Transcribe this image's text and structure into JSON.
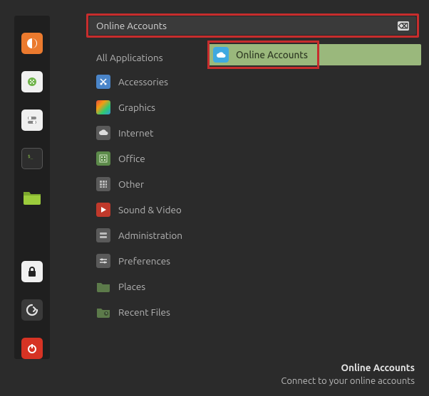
{
  "panel": {
    "items": [
      {
        "name": "firefox-icon"
      },
      {
        "name": "apps-icon"
      },
      {
        "name": "settings-icon"
      },
      {
        "name": "terminal-icon"
      },
      {
        "name": "files-icon"
      }
    ],
    "bottom": [
      {
        "name": "lock-icon"
      },
      {
        "name": "logout-icon"
      },
      {
        "name": "power-icon"
      }
    ]
  },
  "search": {
    "value": "Online Accounts"
  },
  "categories": [
    {
      "label": "All Applications",
      "heading": true
    },
    {
      "label": "Accessories"
    },
    {
      "label": "Graphics"
    },
    {
      "label": "Internet"
    },
    {
      "label": "Office"
    },
    {
      "label": "Other"
    },
    {
      "label": "Sound & Video"
    },
    {
      "label": "Administration"
    },
    {
      "label": "Preferences"
    },
    {
      "label": "Places"
    },
    {
      "label": "Recent Files"
    }
  ],
  "result": {
    "label": "Online Accounts"
  },
  "footer": {
    "title": "Online Accounts",
    "subtitle": "Connect to your online accounts"
  }
}
